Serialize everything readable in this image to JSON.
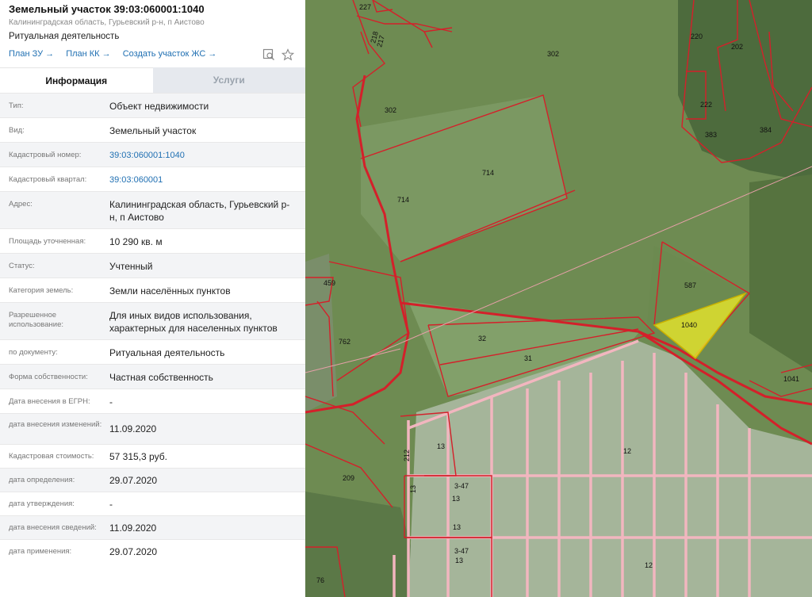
{
  "header": {
    "title": "Земельный участок 39:03:060001:1040",
    "address_short": "Калининградская область, Гурьевский р-н, п Аистово",
    "purpose": "Ритуальная деятельность",
    "links": [
      "План ЗУ →",
      "План КК →",
      "Создать участок ЖС →"
    ],
    "icons": [
      "search-map-icon",
      "star-icon"
    ]
  },
  "tabs": [
    {
      "label": "Информация",
      "active": true
    },
    {
      "label": "Услуги",
      "active": false
    }
  ],
  "rows": [
    {
      "label": "Тип:",
      "value": "Объект недвижимости"
    },
    {
      "label": "Вид:",
      "value": "Земельный участок"
    },
    {
      "label": "Кадастровый номер:",
      "value": "39:03:060001:1040",
      "link": true
    },
    {
      "label": "Кадастровый квартал:",
      "value": "39:03:060001",
      "link": true
    },
    {
      "label": "Адрес:",
      "value": "Калининградская область, Гурьевский р-н, п Аистово"
    },
    {
      "label": "Площадь уточненная:",
      "value": "10 290 кв. м"
    },
    {
      "label": "Статус:",
      "value": "Учтенный"
    },
    {
      "label": "Категория земель:",
      "value": "Земли населённых пунктов"
    },
    {
      "label": "Разрешенное использование:",
      "value": "Для иных видов использования, характерных для населенных пунктов"
    },
    {
      "label": "по документу:",
      "value": "Ритуальная деятельность"
    },
    {
      "label": "Форма собственности:",
      "value": "Частная собственность"
    },
    {
      "label": "Дата внесения в ЕГРН:",
      "value": "-"
    },
    {
      "label": "дата внесения изменений:",
      "value": "11.09.2020"
    },
    {
      "label": "Кадастровая стоимость:",
      "value": "57 315,3 руб."
    },
    {
      "label": "дата определения:",
      "value": "29.07.2020"
    },
    {
      "label": "дата утверждения:",
      "value": "-"
    },
    {
      "label": "дата внесения сведений:",
      "value": "11.09.2020"
    },
    {
      "label": "дата применения:",
      "value": "29.07.2020"
    }
  ],
  "map": {
    "parcel_labels": [
      "227",
      "218",
      "217",
      "302",
      "302",
      "220",
      "202",
      "222",
      "383",
      "384",
      "714",
      "714",
      "587",
      "1040",
      "459",
      "762",
      "32",
      "31",
      "1041",
      "13",
      "212",
      "12",
      "209",
      "13",
      "3-47",
      "13",
      "13",
      "3-47",
      "13",
      "12",
      "76"
    ],
    "colors": {
      "boundary": "#d4202a",
      "selected_fill": "#e8e62a",
      "field": "#6f8f4f",
      "forest": "#4a6a3a"
    }
  }
}
